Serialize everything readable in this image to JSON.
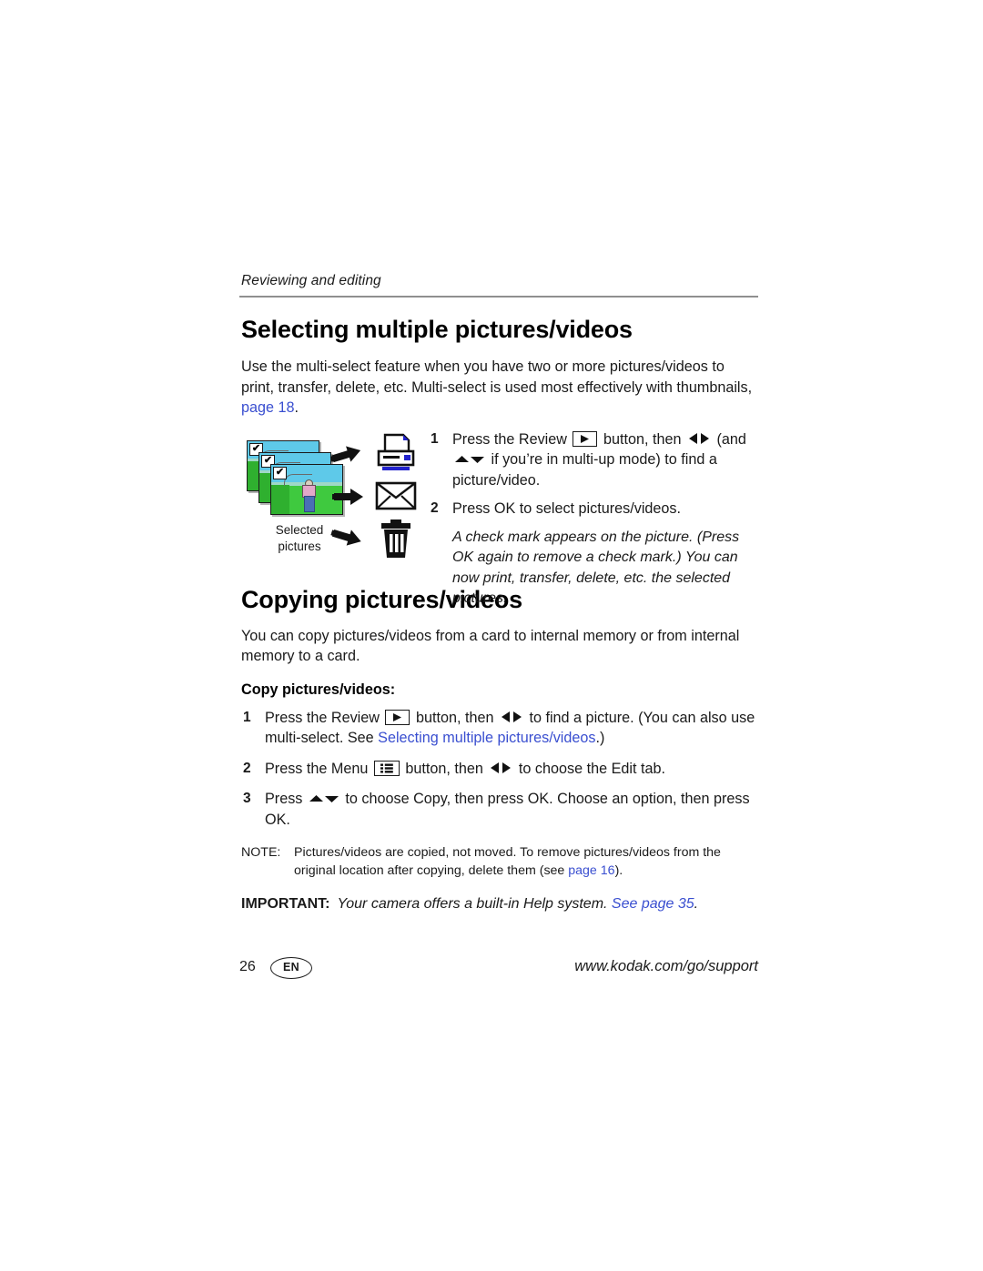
{
  "page": {
    "running_head": "Reviewing and editing",
    "number": "26",
    "language_badge": "EN",
    "support_url": "www.kodak.com/go/support"
  },
  "section_select": {
    "title": "Selecting multiple pictures/videos",
    "intro_before_link": "Use the multi-select feature when you have two or more pictures/videos to print, transfer, delete, etc. Multi-select is used most effectively with thumbnails, ",
    "intro_link": "page 18",
    "intro_after_link": ".",
    "figure": {
      "caption_line1": "Selected",
      "caption_line2": "pictures",
      "checkmark": "✔",
      "destinations": [
        "printer-icon",
        "envelope-icon",
        "trash-icon"
      ],
      "arrow_count": 3
    },
    "steps": [
      {
        "num": "1",
        "part1": "Press the Review ",
        "key": "review-button-icon",
        "part2": " button, then ",
        "arrows1": "left-right-arrows-icon",
        "part3": " (and ",
        "arrows2": "up-down-arrows-icon",
        "part4": " if you’re in multi-up mode) to find a picture/video."
      },
      {
        "num": "2",
        "part1": "Press OK to select pictures/videos."
      }
    ],
    "steps_note": "A check mark appears on the picture. (Press OK again to remove a check mark.) You can now print, transfer, delete, etc. the selected pictures."
  },
  "section_copy": {
    "title": "Copying pictures/videos",
    "intro": "You can copy pictures/videos from a card to internal memory or from internal memory to a card.",
    "subhead": "Copy pictures/videos:",
    "steps": [
      {
        "num": "1",
        "part1": "Press the Review ",
        "key": "review-button-icon",
        "part2": " button, then ",
        "arrows1": "left-right-arrows-icon",
        "part3": " to find a picture. (You can also use multi-select. See ",
        "link": "Selecting multiple pictures/videos",
        "part4": ".)"
      },
      {
        "num": "2",
        "part1": "Press the Menu ",
        "key": "menu-button-icon",
        "part2": " button, then ",
        "arrows1": "left-right-arrows-icon",
        "part3": " to choose the Edit tab."
      },
      {
        "num": "3",
        "part1": "Press ",
        "arrows1": "up-down-arrows-icon",
        "part2": " to choose Copy, then press OK. Choose an option, then press OK."
      }
    ],
    "note": {
      "label": "NOTE:",
      "text_before_link": "Pictures/videos are copied, not moved. To remove pictures/videos from the original location after copying, delete them (see ",
      "link": "page 16",
      "text_after_link": ")."
    },
    "important": {
      "label": "IMPORTANT:",
      "text": "Your camera offers a built-in Help system. ",
      "link": "See page 35",
      "text_after_link": "."
    }
  },
  "colors": {
    "link": "#3a4fd0",
    "rule": "#8f8f8f",
    "text": "#1a1a1a",
    "photo_sky": "#5ec9e9",
    "photo_grass": "#3fc93f",
    "printer_accent": "#2222cc"
  }
}
